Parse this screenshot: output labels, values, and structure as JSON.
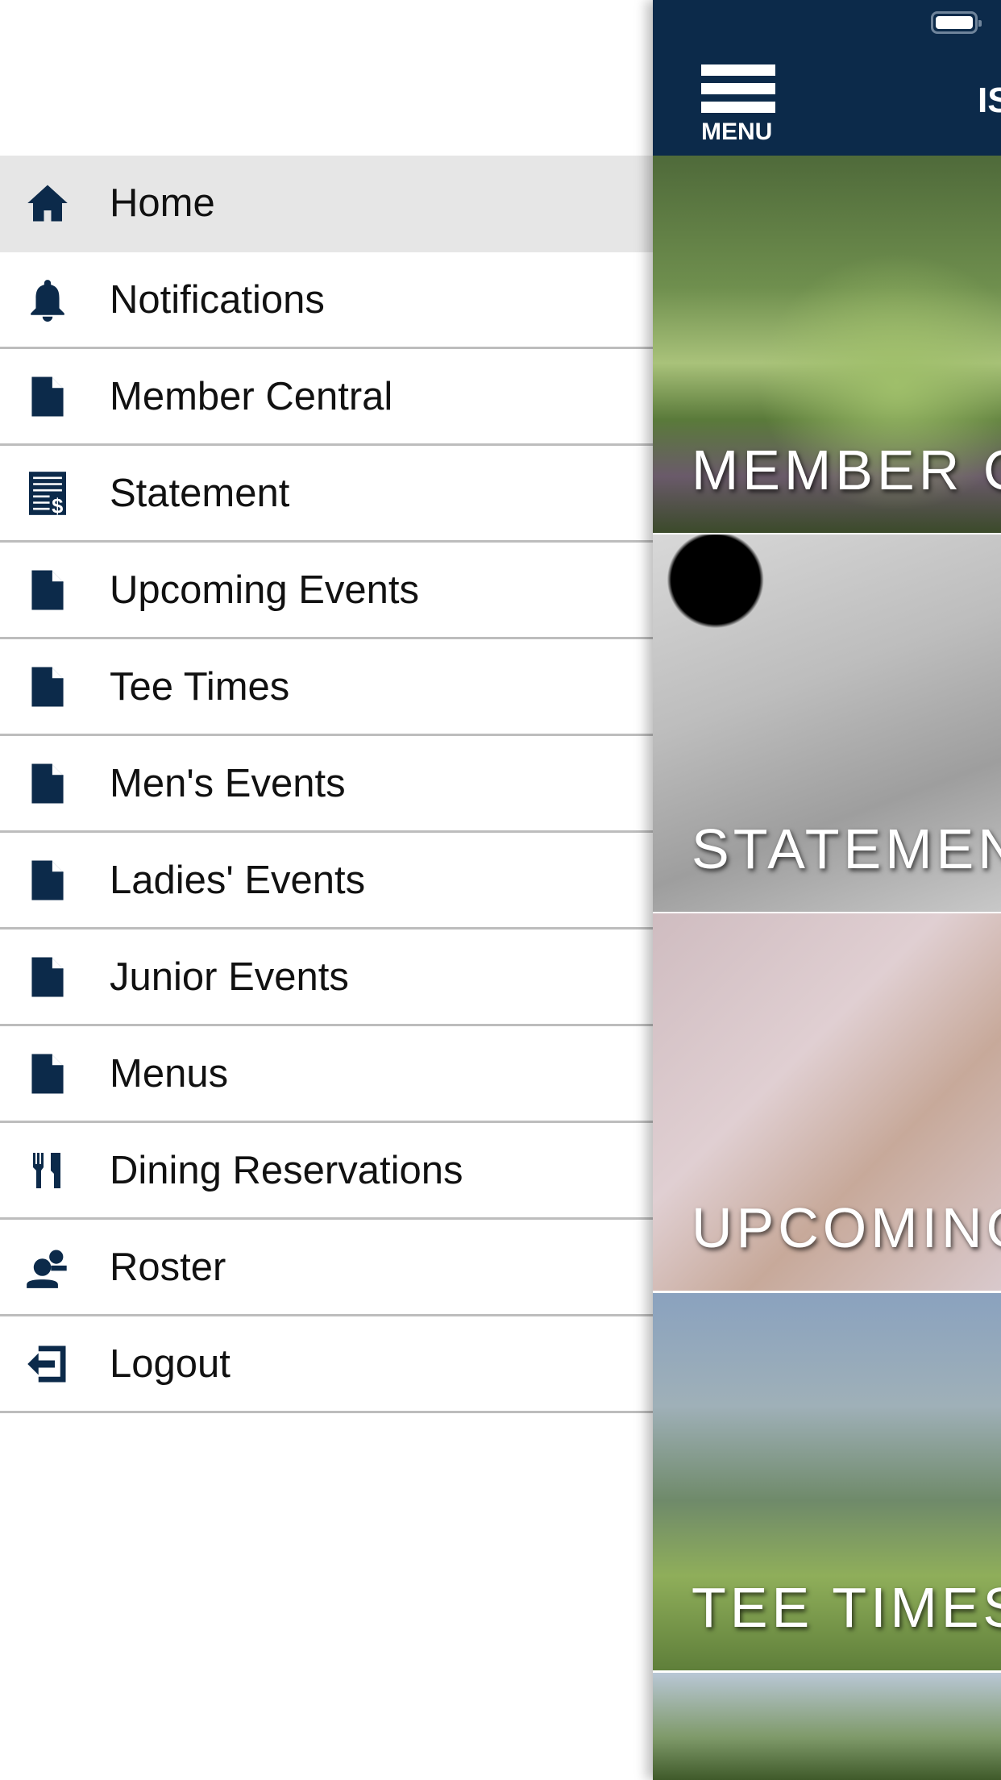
{
  "drawer": {
    "items": [
      {
        "label": "Home",
        "icon": "home-icon",
        "active": true
      },
      {
        "label": "Notifications",
        "icon": "bell-icon"
      },
      {
        "label": "Member Central",
        "icon": "document-icon"
      },
      {
        "label": "Statement",
        "icon": "statement-icon"
      },
      {
        "label": "Upcoming Events",
        "icon": "document-icon"
      },
      {
        "label": "Tee Times",
        "icon": "document-icon"
      },
      {
        "label": "Men's Events",
        "icon": "document-icon"
      },
      {
        "label": "Ladies' Events",
        "icon": "document-icon"
      },
      {
        "label": "Junior Events",
        "icon": "document-icon"
      },
      {
        "label": "Menus",
        "icon": "document-icon"
      },
      {
        "label": "Dining Reservations",
        "icon": "fork-knife-icon"
      },
      {
        "label": "Roster",
        "icon": "people-icon"
      },
      {
        "label": "Logout",
        "icon": "logout-icon"
      }
    ]
  },
  "header": {
    "menu_label": "MENU",
    "title": "IS"
  },
  "tiles": [
    {
      "label": "MEMBER C"
    },
    {
      "label": "STATEMEN"
    },
    {
      "label": "UPCOMING"
    },
    {
      "label": "TEE TIMES"
    },
    {
      "label": ""
    }
  ],
  "colors": {
    "navy": "#0c2a4a",
    "active_row": "#e6e6e6",
    "divider": "#bdbdbd"
  }
}
